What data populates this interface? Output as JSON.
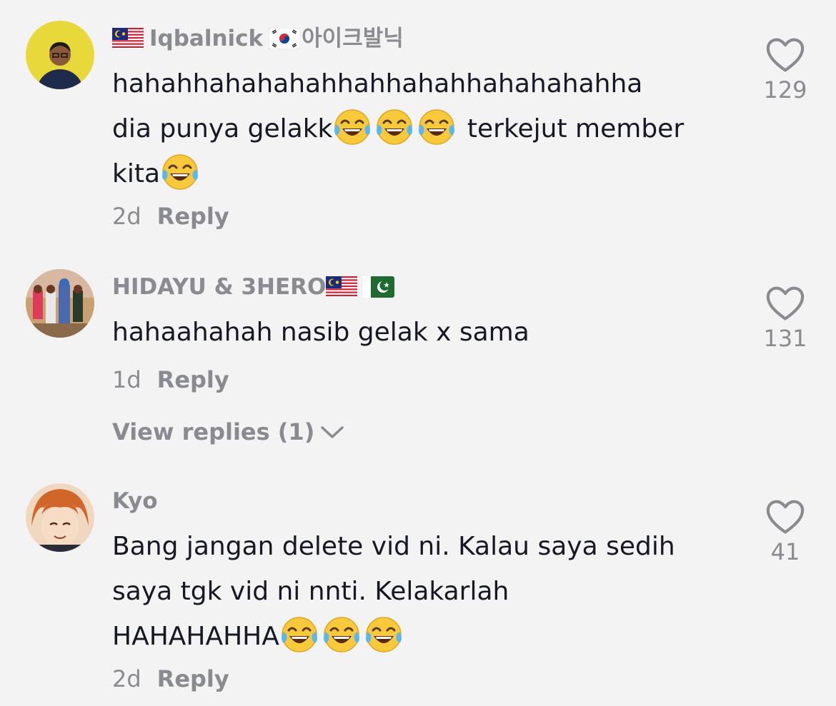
{
  "comments": [
    {
      "username": "Iqbalnick",
      "username_suffix": "아이크발닉",
      "flags": [
        "malaysia-flag",
        "south-korea-flag"
      ],
      "text_lines": [
        "hahahhahahahahhahhahahhahahahahha",
        "dia punya gelakk",
        "terkejut member",
        "kita"
      ],
      "emojis": "😂",
      "time": "2d",
      "reply_label": "Reply",
      "likes": "129"
    },
    {
      "username": "HIDAYU & 3HERO",
      "flags": [
        "malaysia-flag",
        "pakistan-flag"
      ],
      "text": "hahaahahah nasib gelak x sama",
      "time": "1d",
      "reply_label": "Reply",
      "likes": "131",
      "view_replies": "View replies (1)"
    },
    {
      "username": "Kyo",
      "text_lines": [
        "Bang jangan delete vid ni. Kalau saya sedih",
        "saya tgk vid ni nnti. Kelakarlah",
        "HAHAHAHHA"
      ],
      "emojis": "😂",
      "time": "2d",
      "reply_label": "Reply",
      "likes": "41"
    }
  ],
  "icons": {
    "like": "heart-outline-icon",
    "expand": "chevron-down-icon",
    "emoji": "face-with-tears-of-joy"
  },
  "colors": {
    "background": "#f4f3f3",
    "text": "#161823",
    "secondary": "#8a8b91"
  }
}
